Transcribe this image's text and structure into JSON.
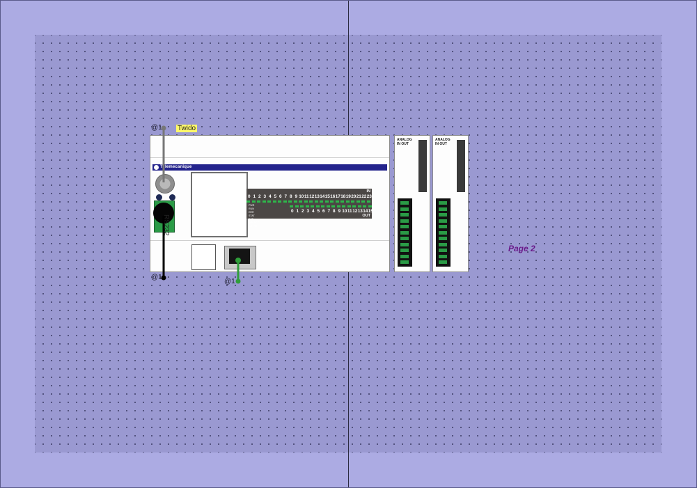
{
  "canvas": {
    "background": "#acabe3",
    "work_area": "#9a99d1"
  },
  "pages": {
    "page2_label": "Page 2"
  },
  "connections": {
    "top_left_label": "@1",
    "bottom_left_label": "@1",
    "bottom_mid_label": "@1"
  },
  "controller": {
    "name": "Twido",
    "brand": "Telemecanique",
    "rs232_label": "RS232",
    "io_in_label": "IN",
    "io_out_label": "OUT",
    "inputs": [
      "0",
      "1",
      "2",
      "3",
      "4",
      "5",
      "6",
      "7",
      "8",
      "9",
      "10",
      "11",
      "12",
      "13",
      "14",
      "15",
      "16",
      "17",
      "18",
      "19",
      "20",
      "21",
      "22",
      "23"
    ],
    "outputs": [
      "0",
      "1",
      "2",
      "3",
      "4",
      "5",
      "6",
      "7",
      "8",
      "9",
      "10",
      "11",
      "12",
      "13",
      "14",
      "15"
    ],
    "status_leds": [
      "PWR",
      "RUN",
      "ERR",
      "STAT",
      "BAT",
      "LAN ACT",
      "LAN ST"
    ]
  },
  "modules": [
    {
      "title_line1": "ANALOG",
      "title_line2": "IN   OUT"
    },
    {
      "title_line1": "ANALOG",
      "title_line2": "IN   OUT"
    }
  ],
  "colors": {
    "wire_gray": "#777777",
    "wire_black": "#000000",
    "wire_green": "#2f9e3a",
    "brand_bar": "#23238c",
    "page_label": "#6a1a8a",
    "name_tag": "#fff86a"
  }
}
